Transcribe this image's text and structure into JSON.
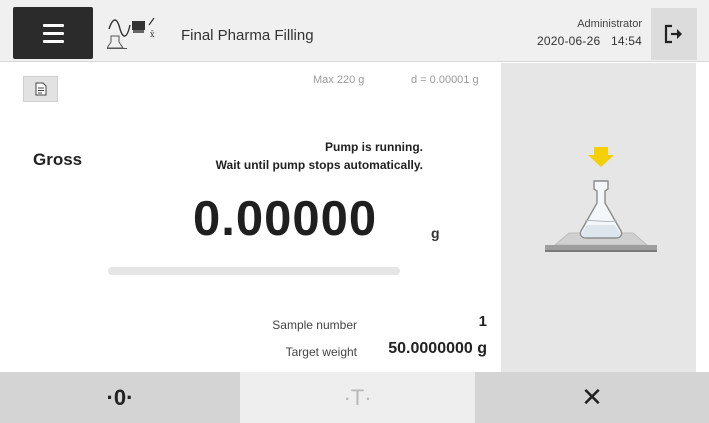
{
  "header": {
    "menu_icon": "hamburger-menu-icon",
    "method_icon": "filling-method-icon",
    "title": "Final Pharma Filling",
    "user": "Administrator",
    "date": "2020-06-26",
    "time": "14:54",
    "logout_icon": "logout-icon"
  },
  "weighing": {
    "capacity": "Max 220 g",
    "readability": "d = 0.00001 g",
    "mode": "Gross",
    "status_line1": "Pump is running.",
    "status_line2": "Wait until pump stops automatically.",
    "value": "0.00000",
    "unit": "g",
    "progress_fraction": 0.0,
    "sample_label": "Sample number",
    "sample_value": "1",
    "target_label": "Target weight",
    "target_value": "50.0000000 g"
  },
  "graphic": {
    "icon": "flask-on-pan-icon",
    "arrow_color": "#f5d000"
  },
  "footer": {
    "zero_label": "·0·",
    "tare_label": "·T·",
    "cancel_label": "✕"
  }
}
